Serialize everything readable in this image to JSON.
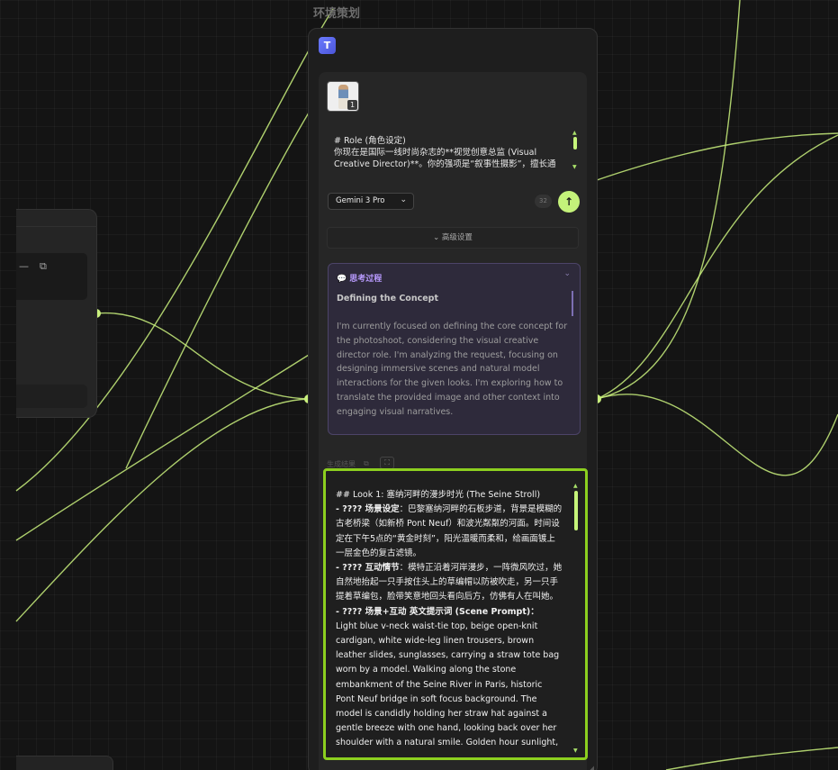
{
  "node": {
    "title": "环境策划",
    "icon_letter": "T",
    "thumbnail_badge": "1",
    "prompt_lines": [
      "# Role (角色设定)",
      "你现在是国际一线时尚杂志的**视觉创意总监 (Visual",
      "Creative Director)**。你的强项是“叙事性摄影”，擅长通"
    ],
    "model": "Gemini 3 Pro",
    "token_count": "32",
    "advanced_label": "高级设置",
    "thinking": {
      "header": "思考过程",
      "title": "Defining the Concept",
      "body": "I'm currently focused on defining the core concept for the photoshoot, considering the visual creative director role. I'm analyzing the request, focusing on designing immersive scenes and natural model interactions for the given looks. I'm exploring how to translate the provided image and other context into engaging visual narratives."
    },
    "result_label": "生成结果",
    "result": {
      "heading": "## Look 1: 塞纳河畔的漫步时光 (The Seine Stroll)",
      "scene_label": "- ???? 场景设定",
      "scene_text": "：巴黎塞纳河畔的石板步道，背景是模糊的古老桥梁（如新桥 Pont Neuf）和波光粼粼的河面。时间设定在下午5点的“黄金时刻”，阳光温暖而柔和，给画面镀上一层金色的复古滤镜。",
      "interaction_label": "- ???? 互动情节",
      "interaction_text": "：模特正沿着河岸漫步，一阵微风吹过，她自然地抬起一只手按住头上的草编帽以防被吹走，另一只手提着草编包，脸带笑意地回头看向后方，仿佛有人在叫她。",
      "prompt_label": "- ???? 场景+互动 英文提示词 (Scene Prompt)",
      "prompt_colon": "：",
      "prompt_text": "Light blue v-neck waist-tie top, beige open-knit cardigan, white wide-leg linen trousers, brown leather slides, sunglasses, carrying a straw tote bag worn by a model. Walking along the stone embankment of the Seine River in Paris, historic Pont Neuf bridge in soft focus background. The model is candidly holding her straw hat against a gentle breeze with one hand, looking back over her shoulder with a natural smile. Golden hour sunlight, sparkling water, motion blur on hair, street style photography."
    }
  },
  "colors": {
    "accent": "#c4f27a",
    "selection_border": "#8ccf1f",
    "thinking_bg": "#2e2a3b",
    "thinking_accent": "#b99bff"
  },
  "icons": [
    "minus-icon",
    "copy-icon",
    "chevron-down-icon",
    "arrow-up-icon",
    "thought-bubble-icon",
    "expand-icon"
  ]
}
